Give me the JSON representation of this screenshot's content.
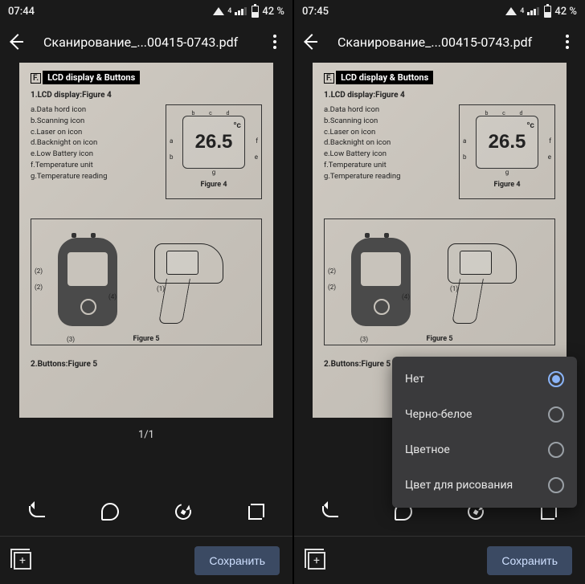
{
  "panes": [
    {
      "status": {
        "time": "07:44",
        "battery": "42 %",
        "signal_sub": "4"
      },
      "appbar": {
        "title": "Сканирование_...00415-0743.pdf"
      },
      "doc": {
        "header_prefix": "F.",
        "header": "LCD display & Buttons",
        "line1": "1.LCD display:Figure 4",
        "legend": [
          "a.Data hord icon",
          "b.Scanning icon",
          "c.Laser on icon",
          "d.Backnight on icon",
          "e.Low Battery icon",
          "f.Temperature unit",
          "g.Temperature reading"
        ],
        "lcd": {
          "value": "26.5",
          "unit": "°c",
          "caption": "Figure 4"
        },
        "fig5_caption": "Figure 5",
        "callouts": {
          "c1": "(2)",
          "c2": "(2)",
          "c3": "(3)",
          "c4": "(4)",
          "c5": "(1)"
        },
        "buttons_line": "2.Buttons:Figure 5",
        "page_counter": "1/1"
      },
      "bottom": {
        "save": "Сохранить"
      },
      "popup": null
    },
    {
      "status": {
        "time": "07:45",
        "battery": "42 %",
        "signal_sub": "4"
      },
      "appbar": {
        "title": "Сканирование_...00415-0743.pdf"
      },
      "doc": {
        "header_prefix": "F.",
        "header": "LCD display & Buttons",
        "line1": "1.LCD display:Figure 4",
        "legend": [
          "a.Data hord icon",
          "b.Scanning icon",
          "c.Laser on icon",
          "d.Backnight on icon",
          "e.Low Battery icon",
          "f.Temperature unit",
          "g.Temperature reading"
        ],
        "lcd": {
          "value": "26.5",
          "unit": "°c",
          "caption": "Figure 4"
        },
        "fig5_caption": "Figure 5",
        "callouts": {
          "c1": "(2)",
          "c2": "(2)",
          "c3": "(3)",
          "c4": "(4)",
          "c5": "(1)"
        },
        "buttons_line": "2.Buttons:Figure 5",
        "page_counter": ""
      },
      "bottom": {
        "save": "Сохранить"
      },
      "popup": {
        "items": [
          {
            "label": "Нет",
            "selected": true
          },
          {
            "label": "Черно-белое",
            "selected": false
          },
          {
            "label": "Цветное",
            "selected": false
          },
          {
            "label": "Цвет для рисования",
            "selected": false
          }
        ]
      }
    }
  ]
}
